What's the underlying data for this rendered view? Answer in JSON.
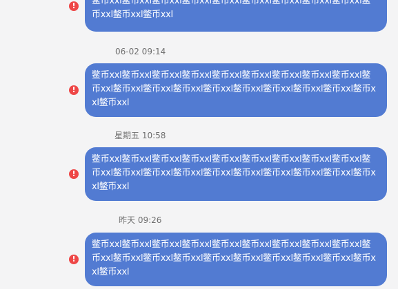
{
  "messages": [
    {
      "timestamp": "",
      "text": "鳖币xxl鳖币xxl鳖币xxl鳖币xxl鳖币xxl鳖币xxl鳖币xxl鳖币xxl鳖币xxl鳖币xxl鳖币xxl鳖币xxl"
    },
    {
      "timestamp": "06-02 09:14",
      "text": "鳖币xxl鳖币xxl鳖币xxl鳖币xxl鳖币xxl鳖币xxl鳖币xxl鳖币xxl鳖币xxl鳖币xxl鳖币xxl鳖币xxl鳖币xxl鳖币xxl鳖币xxl鳖币xxl鳖币xxl鳖币xxl鳖币xxl鳖币xxl"
    },
    {
      "timestamp": "星期五 10:58",
      "text": "鳖币xxl鳖币xxl鳖币xxl鳖币xxl鳖币xxl鳖币xxl鳖币xxl鳖币xxl鳖币xxl鳖币xxl鳖币xxl鳖币xxl鳖币xxl鳖币xxl鳖币xxl鳖币xxl鳖币xxl鳖币xxl鳖币xxl鳖币xxl"
    },
    {
      "timestamp": "昨天 09:26",
      "text": "鳖币xxl鳖币xxl鳖币xxl鳖币xxl鳖币xxl鳖币xxl鳖币xxl鳖币xxl鳖币xxl鳖币xxl鳖币xxl鳖币xxl鳖币xxl鳖币xxl鳖币xxl鳖币xxl鳖币xxl鳖币xxl鳖币xxl鳖币xxl"
    }
  ],
  "error_icon": "!",
  "colors": {
    "background": "#f4f4f5",
    "bubble": "#527bd2",
    "bubble_text": "#ffffff",
    "error": "#ee4747",
    "timestamp": "#6f6f6f"
  }
}
